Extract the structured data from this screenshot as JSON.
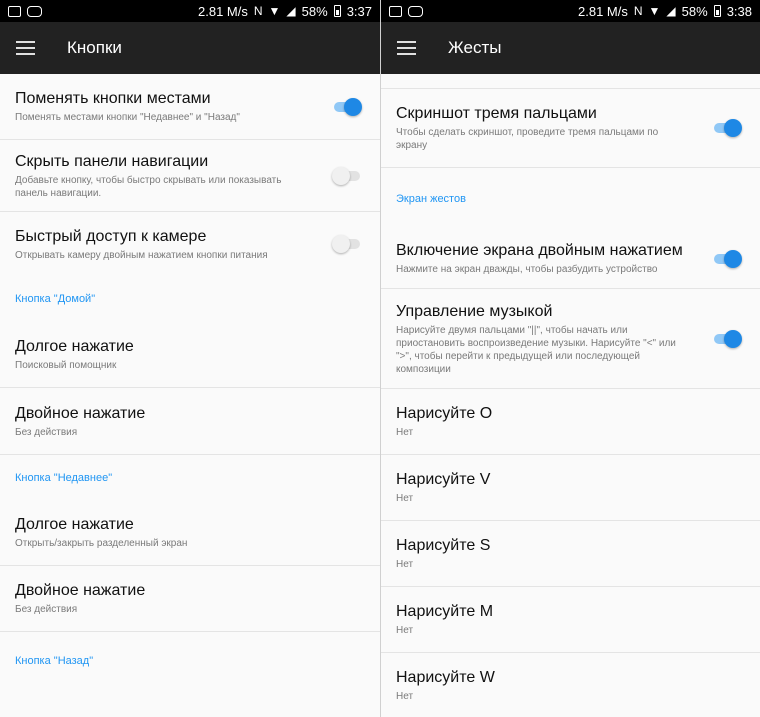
{
  "left": {
    "status": {
      "speed": "2.81 M/s",
      "battery": "58%",
      "time": "3:37"
    },
    "title": "Кнопки",
    "items": [
      {
        "title": "Поменять кнопки местами",
        "subtitle": "Поменять местами кнопки \"Недавнее\" и \"Назад\"",
        "toggle": true
      },
      {
        "title": "Скрыть панели навигации",
        "subtitle": "Добавьте кнопку, чтобы быстро скрывать или показывать панель навигации.",
        "toggle": false
      },
      {
        "title": "Быстрый доступ к камере",
        "subtitle": "Открывать камеру двойным нажатием кнопки питания",
        "toggle": false
      }
    ],
    "section_home": "Кнопка \"Домой\"",
    "home_items": [
      {
        "title": "Долгое нажатие",
        "subtitle": "Поисковый помощник"
      },
      {
        "title": "Двойное нажатие",
        "subtitle": "Без действия"
      }
    ],
    "section_recent": "Кнопка \"Недавнее\"",
    "recent_items": [
      {
        "title": "Долгое нажатие",
        "subtitle": "Открыть/закрыть разделенный экран"
      },
      {
        "title": "Двойное нажатие",
        "subtitle": "Без действия"
      }
    ],
    "section_back": "Кнопка \"Назад\""
  },
  "right": {
    "status": {
      "speed": "2.81 M/s",
      "battery": "58%",
      "time": "3:38"
    },
    "title": "Жесты",
    "items": [
      {
        "title": "Скриншот тремя пальцами",
        "subtitle": "Чтобы сделать скриншот, проведите тремя пальцами по экрану",
        "toggle": true
      }
    ],
    "section_gestures": "Экран жестов",
    "gesture_items": [
      {
        "title": "Включение экрана двойным нажатием",
        "subtitle": "Нажмите на экран дважды, чтобы разбудить устройство",
        "toggle": true
      },
      {
        "title": "Управление музыкой",
        "subtitle": "Нарисуйте двумя пальцами \"||\", чтобы начать или приостановить воспроизведение музыки. Нарисуйте \"<\" или \">\", чтобы перейти к предыдущей или последующей композиции",
        "toggle": true
      }
    ],
    "draw_items": [
      {
        "title": "Нарисуйте O",
        "subtitle": "Нет"
      },
      {
        "title": "Нарисуйте V",
        "subtitle": "Нет"
      },
      {
        "title": "Нарисуйте S",
        "subtitle": "Нет"
      },
      {
        "title": "Нарисуйте M",
        "subtitle": "Нет"
      },
      {
        "title": "Нарисуйте W",
        "subtitle": "Нет"
      }
    ]
  },
  "colors": {
    "accent": "#2196f3",
    "toggle_on": "#1e88e5",
    "appbar": "#222222",
    "statusbar": "#000000",
    "background": "#fafafa"
  }
}
